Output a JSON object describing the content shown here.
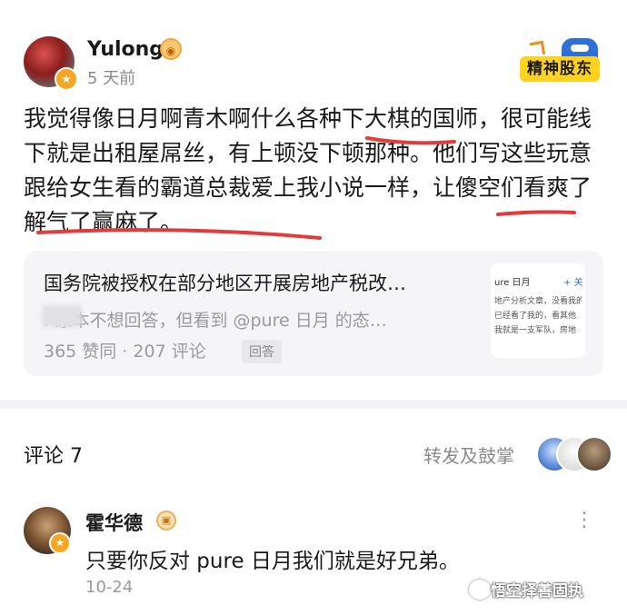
{
  "post": {
    "author": "Yulong",
    "time": "5 天前",
    "badge_icon": "medal-icon",
    "brand_badge": "精神股东",
    "body": "我觉得像日月啊青木啊什么各种下大棋的国师，很可能线下就是出租屋屌丝，有上顿没下顿那种。他们写这些玩意跟给女生看的霸道总裁爱上我小说一样，让傻空们看爽了解气了赢麻了。",
    "annotation_color": "#e33b3b"
  },
  "quote": {
    "title": "国务院被授权在部分地区开展房地产税改…",
    "snippet": ": 原本不想回答，但看到 @pure 日月 的态…",
    "stats": "365 赞同 · 207 评论",
    "tag": "回答",
    "thumb": {
      "title": "ure 日月",
      "follow": "+ 关",
      "lines": [
        "地产分析文章，没看我的",
        "已经看了我的，看其他",
        "我就是一支军队，房地"
      ]
    }
  },
  "comments": {
    "title": "评论 7",
    "repost_label": "转发及鼓掌",
    "items": [
      {
        "author": "霍华德",
        "text": "只要你反对 pure 日月我们就是好兄弟。",
        "date": "10-24",
        "more_icon": "more-dots-icon"
      }
    ]
  },
  "watermark": "悟空择善固执",
  "colors": {
    "accent_yellow": "#ffd21f",
    "badge_orange": "#f5a623",
    "muted_text": "#9a9a9a",
    "card_bg": "#f5f5f7"
  }
}
